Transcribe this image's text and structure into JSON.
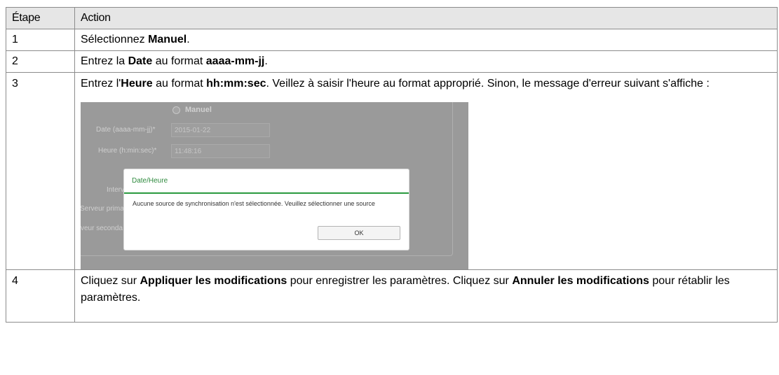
{
  "table": {
    "headers": [
      "Étape",
      "Action"
    ],
    "rows": [
      {
        "step": "1",
        "parts": [
          "Sélectionnez ",
          "Manuel",
          "."
        ]
      },
      {
        "step": "2",
        "parts": [
          "Entrez la ",
          "Date",
          " au format ",
          "aaaa-mm-jj",
          "."
        ]
      },
      {
        "step": "3",
        "parts": [
          "Entrez l'",
          "Heure",
          " au format ",
          "hh:mm:sec",
          ". Veillez à saisir l'heure au format approprié. Sinon, le message d'erreur suivant s'affiche :"
        ]
      },
      {
        "step": "4",
        "parts": [
          "Cliquez sur ",
          "Appliquer les modifications",
          " pour enregistrer les paramètres. Cliquez sur ",
          "Annuler les modifications",
          " pour rétablir les paramètres."
        ]
      }
    ]
  },
  "screenshot": {
    "radio_label": "Manuel",
    "date_label": "Date (aaaa-mm-jj)*",
    "date_value": "2015-01-22",
    "time_label": "Heure (h:min:sec)*",
    "time_value": "11:48:16",
    "interval_label": "Interv",
    "primary_label": "Serveur primai",
    "secondary_label": "veur seconda",
    "dialog": {
      "title": "Date/Heure",
      "message": "Aucune source de synchronisation n'est sélectionnée. Veuillez sélectionner une source",
      "ok_label": "OK",
      "accent_color": "#2a9a3f"
    }
  }
}
